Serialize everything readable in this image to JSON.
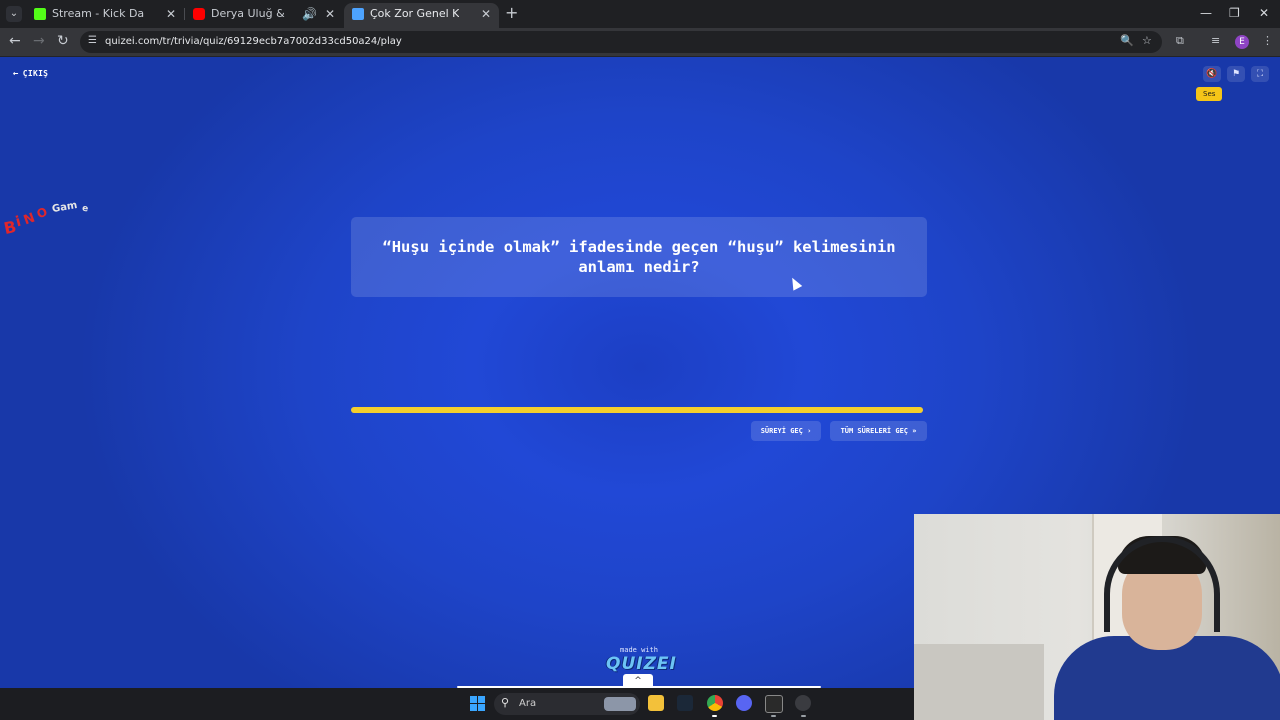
{
  "browser": {
    "tabs": [
      {
        "title": "Stream - Kick Dashboard",
        "favicon": "kick-icon",
        "active": false
      },
      {
        "title": "Derya Uluğ & Asil Gök - Yo",
        "favicon": "youtube-icon",
        "active": false
      },
      {
        "title": "Çok Zor Genel Kültür Testi Parti",
        "favicon": "quizei-icon",
        "active": true
      }
    ],
    "url": "quizei.com/tr/trivia/quiz/69129ecb7a7002d33cd50a24/play",
    "profile_initial": "E"
  },
  "page": {
    "exit_label": "ÇIKIŞ",
    "tooltip": "Ses",
    "watermark": "BiNOGame",
    "question": "“Huşu içinde olmak” ifadesinde geçen “huşu” kelimesinin anlamı nedir?",
    "timer_progress": 1.0,
    "skip_time_label": "SÜREYİ GEÇ",
    "skip_all_label": "TÜM SÜRELERİ GEÇ",
    "made_with": "made with",
    "brand": "QUIZEI",
    "colors": {
      "accent": "#f5cf2c",
      "background": "#1e44c8"
    }
  },
  "taskbar": {
    "search_placeholder": "Ara"
  }
}
